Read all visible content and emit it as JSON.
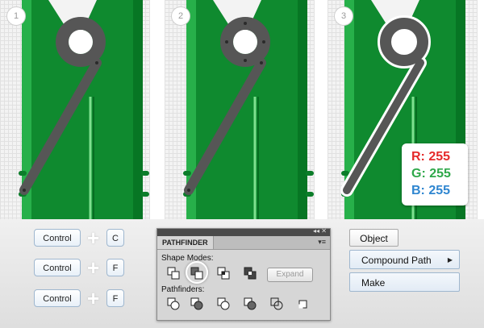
{
  "steps": [
    {
      "number": "1"
    },
    {
      "number": "2"
    },
    {
      "number": "3"
    }
  ],
  "rgb": {
    "r_label": "R: 255",
    "g_label": "G: 255",
    "b_label": "B: 255",
    "r_color": "#e52a2a",
    "g_color": "#2fa84a",
    "b_color": "#2f86d0"
  },
  "shortcuts": [
    {
      "modifier": "Control",
      "plus": "+",
      "key": "C"
    },
    {
      "modifier": "Control",
      "plus": "+",
      "key": "F"
    },
    {
      "modifier": "Control",
      "plus": "+",
      "key": "F"
    }
  ],
  "pathfinder": {
    "title": "PATHFINDER",
    "panel_controls": "◂◂ ✕",
    "menu_glyph": "▾≡",
    "shape_modes_label": "Shape Modes:",
    "pathfinders_label": "Pathfinders:",
    "expand_label": "Expand"
  },
  "menu": {
    "object_label": "Object",
    "compound_path_label": "Compound Path",
    "submenu_arrow": "▶",
    "make_label": "Make"
  },
  "colors": {
    "green_dark": "#0b7a2a",
    "green_mid": "#1a9a3a",
    "green_light": "#35c45a",
    "stroke_gray": "#565656",
    "accent_blue": "#9fb7cf"
  }
}
